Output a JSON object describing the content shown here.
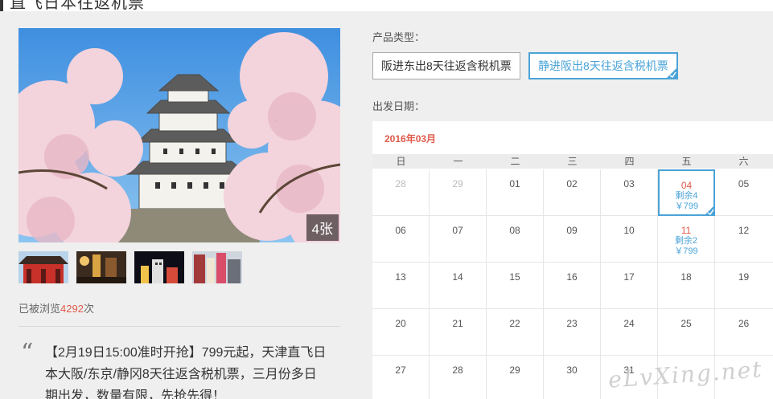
{
  "header": {
    "title": "直飞日本往返机票"
  },
  "gallery": {
    "photo_count": "4张",
    "thumbnails": [
      "temple",
      "street",
      "night-city",
      "shopping-street"
    ]
  },
  "views": {
    "prefix": "已被浏览",
    "count": "4292",
    "suffix": "次"
  },
  "promo": {
    "quote_mark": "“",
    "text": "【2月19日15:00准时开抢】799元起，天津直飞日本大阪/东京/静冈8天往返含税机票，三月份多日期出发，数量有限，先抢先得！"
  },
  "product": {
    "label": "产品类型：",
    "options": [
      {
        "label": "阪进东出8天往返含税机票",
        "selected": false
      },
      {
        "label": "静进阪出8天往返含税机票",
        "selected": true
      }
    ]
  },
  "departure": {
    "label": "出发日期："
  },
  "calendar": {
    "month": "2016年03月",
    "weekdays": [
      "日",
      "一",
      "二",
      "三",
      "四",
      "五",
      "六"
    ],
    "weeks": [
      [
        {
          "day": "28",
          "muted": true
        },
        {
          "day": "29",
          "muted": true
        },
        {
          "day": "01"
        },
        {
          "day": "02"
        },
        {
          "day": "03"
        },
        {
          "day": "04",
          "stock": "剩余4",
          "price": "￥799",
          "selected": true
        },
        {
          "day": "05"
        }
      ],
      [
        {
          "day": "06"
        },
        {
          "day": "07"
        },
        {
          "day": "08"
        },
        {
          "day": "09"
        },
        {
          "day": "10"
        },
        {
          "day": "11",
          "stock": "剩余2",
          "price": "￥799"
        },
        {
          "day": "12"
        }
      ],
      [
        {
          "day": "13"
        },
        {
          "day": "14"
        },
        {
          "day": "15"
        },
        {
          "day": "16"
        },
        {
          "day": "17"
        },
        {
          "day": "18"
        },
        {
          "day": "19"
        }
      ],
      [
        {
          "day": "20"
        },
        {
          "day": "21"
        },
        {
          "day": "22"
        },
        {
          "day": "23"
        },
        {
          "day": "24"
        },
        {
          "day": "25"
        },
        {
          "day": "26"
        }
      ],
      [
        {
          "day": "27"
        },
        {
          "day": "28"
        },
        {
          "day": "29"
        },
        {
          "day": "30"
        },
        {
          "day": "31"
        },
        {
          "day": ""
        },
        {
          "day": ""
        }
      ]
    ]
  },
  "watermark": "eLvXing.net",
  "colors": {
    "accent": "#4aa3d8",
    "highlight": "#e05a4a",
    "panel": "#efefef"
  }
}
